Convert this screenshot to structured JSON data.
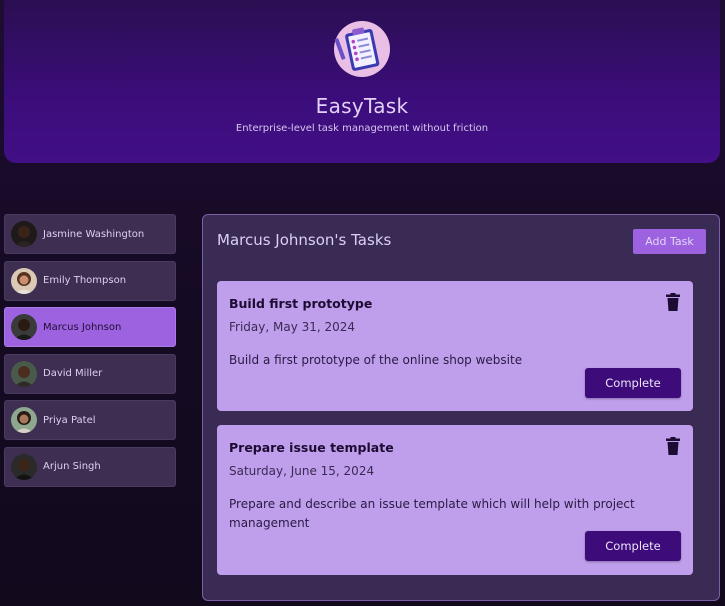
{
  "header": {
    "title": "EasyTask",
    "subtitle": "Enterprise-level task management without friction",
    "logo_icon": "task-clipboard-icon"
  },
  "users": [
    {
      "name": "Jasmine Washington",
      "active": false,
      "avatar_color": "#3a2418"
    },
    {
      "name": "Emily Thompson",
      "active": false,
      "avatar_color": "#7a4a30"
    },
    {
      "name": "Marcus Johnson",
      "active": true,
      "avatar_color": "#2b1a12"
    },
    {
      "name": "David Miller",
      "active": false,
      "avatar_color": "#4a2d1e"
    },
    {
      "name": "Priya Patel",
      "active": false,
      "avatar_color": "#6a4a38"
    },
    {
      "name": "Arjun Singh",
      "active": false,
      "avatar_color": "#3c261a"
    }
  ],
  "tasks_panel": {
    "title": "Marcus Johnson's Tasks",
    "add_task_label": "Add Task",
    "tasks": [
      {
        "title": "Build first prototype",
        "date": "Friday, May 31, 2024",
        "description": "Build a first prototype of the online shop website",
        "complete_label": "Complete"
      },
      {
        "title": "Prepare issue template",
        "date": "Saturday, June 15, 2024",
        "description": "Prepare and describe an issue template which will help with project management",
        "complete_label": "Complete"
      }
    ]
  },
  "colors": {
    "accent": "#9c62e0",
    "card": "#bf9eeb",
    "button_dark": "#3d0c7a",
    "header": "#3b0d7a"
  }
}
